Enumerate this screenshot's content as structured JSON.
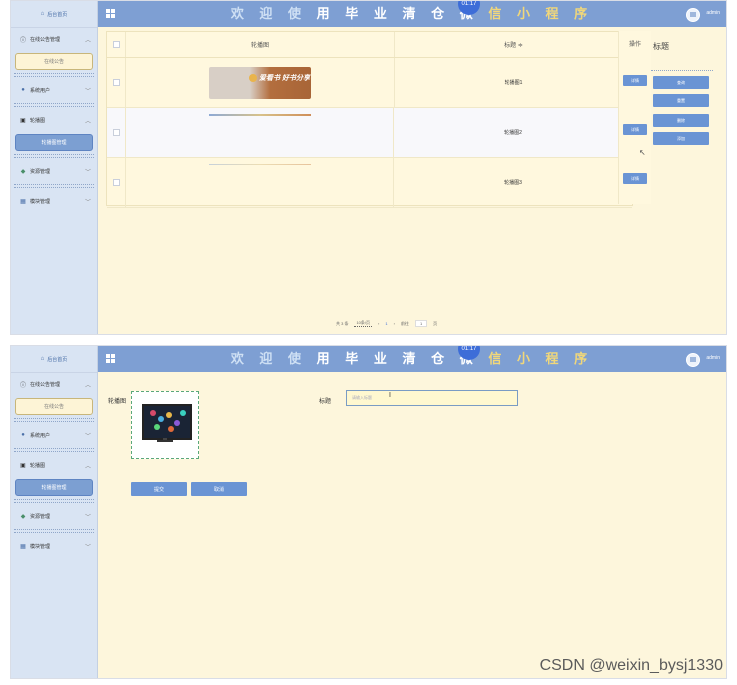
{
  "app": {
    "title_plain1": "欢 迎 使 ",
    "title_hl": "用 毕 业 清 仓 微",
    "title_yl": " 信 小 程 序",
    "clock": "01:17",
    "user": "admin",
    "home": "后台首页"
  },
  "sidebar": {
    "menus": [
      {
        "label": "在线公告管理",
        "sub": "在线公告"
      },
      {
        "label": "系统用户"
      },
      {
        "label": "轮播图",
        "sub": "轮播图管理"
      },
      {
        "label": "资源管理"
      },
      {
        "label": "模块管理"
      }
    ]
  },
  "table": {
    "headers": {
      "image": "轮播图",
      "title": "标题 ≑",
      "op": "操作"
    },
    "rows": [
      {
        "title": "轮播图1",
        "btn": "详情",
        "banner_text": "爱看书 好书分享"
      },
      {
        "title": "轮播图2",
        "btn": "详情"
      },
      {
        "title": "轮播图3",
        "btn": "详情"
      }
    ]
  },
  "right_panel": {
    "title": "标题",
    "buttons": [
      "查询",
      "重置",
      "删除",
      "添加"
    ]
  },
  "pager": {
    "total": "共 3 条",
    "size": "10条/页",
    "current": "1",
    "goto_label": "前往",
    "goto_value": "1",
    "page_unit": "页"
  },
  "form": {
    "image_label": "轮播图",
    "title_label": "标题",
    "title_placeholder": "请输入标题",
    "submit": "提交",
    "cancel": "取消"
  },
  "watermark": "CSDN @weixin_bysj1330",
  "colors": {
    "topbar": "#7e9fd3",
    "sidebar": "#d9e4f3",
    "content": "#fdf6dc",
    "button": "#6a94d4"
  }
}
